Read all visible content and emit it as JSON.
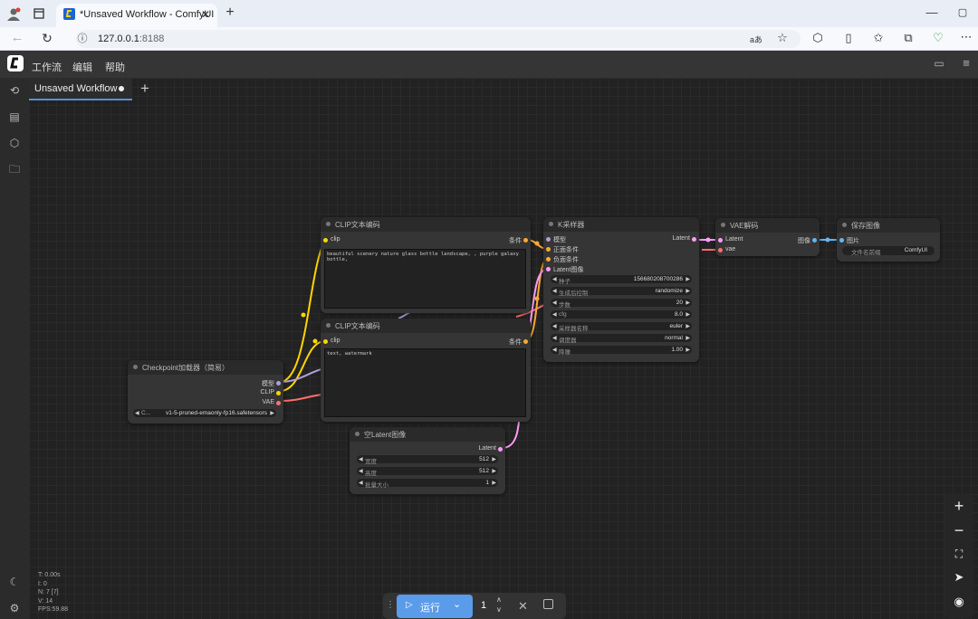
{
  "browser": {
    "tab_title": "*Unsaved Workflow - ComfyUI",
    "url_host": "127.0.0.1",
    "url_port": ":8188",
    "new_tab": "+",
    "read_aloud": "aあ"
  },
  "menu": {
    "items": [
      "工作流",
      "编辑",
      "帮助"
    ]
  },
  "workflow_tab": {
    "label": "Unsaved Workflow",
    "add": "+"
  },
  "nodes": {
    "clip1": {
      "title": "CLIP文本编码",
      "input": "clip",
      "output": "条件",
      "text": "beautiful scenery nature glass bottle landscape, , purple galaxy bottle,"
    },
    "clip2": {
      "title": "CLIP文本编码",
      "input": "clip",
      "output": "条件",
      "text": "text, watermark"
    },
    "checkpoint": {
      "title": "Checkpoint加载器（简易）",
      "outputs": [
        "模型",
        "CLIP",
        "VAE"
      ],
      "widget_value": "v1-5-pruned-emaonly-fp16.safetensors",
      "widget_prefix": "C..."
    },
    "ksampler": {
      "title": "K采样器",
      "inputs": [
        "模型",
        "正面条件",
        "负面条件",
        "Latent图像"
      ],
      "output": "Latent",
      "widgets": [
        {
          "label": "种子",
          "value": "156680208700286"
        },
        {
          "label": "生成后控制",
          "value": "randomize"
        },
        {
          "label": "步数",
          "value": "20"
        },
        {
          "label": "cfg",
          "value": "8.0"
        },
        {
          "label": "采样器名称",
          "value": "euler"
        },
        {
          "label": "调度器",
          "value": "normal"
        },
        {
          "label": "降噪",
          "value": "1.00"
        }
      ]
    },
    "vae_decode": {
      "title": "VAE解码",
      "inputs": [
        "Latent",
        "vae"
      ],
      "output": "图像"
    },
    "save_image": {
      "title": "保存图像",
      "input": "图片",
      "widget_label": "文件名前缀",
      "widget_value": "ComfyUI"
    },
    "empty_latent": {
      "title": "空Latent图像",
      "output": "Latent",
      "widgets": [
        {
          "label": "宽度",
          "value": "512"
        },
        {
          "label": "高度",
          "value": "512"
        },
        {
          "label": "批量大小",
          "value": "1"
        }
      ]
    }
  },
  "stats": [
    "T: 0.00s",
    "I: 0",
    "N: 7 [7]",
    "V: 14",
    "FPS:59.88"
  ],
  "run": {
    "label": "运行",
    "count": "1"
  },
  "colors": {
    "accent": "#5a9bea",
    "clip_wire": "#ffd500",
    "model_wire": "#b39ddb",
    "vae_wire": "#ff6e6e",
    "latent_wire": "#ff9cf9",
    "cond_wire": "#ffa931",
    "image_wire": "#64b5f6"
  }
}
